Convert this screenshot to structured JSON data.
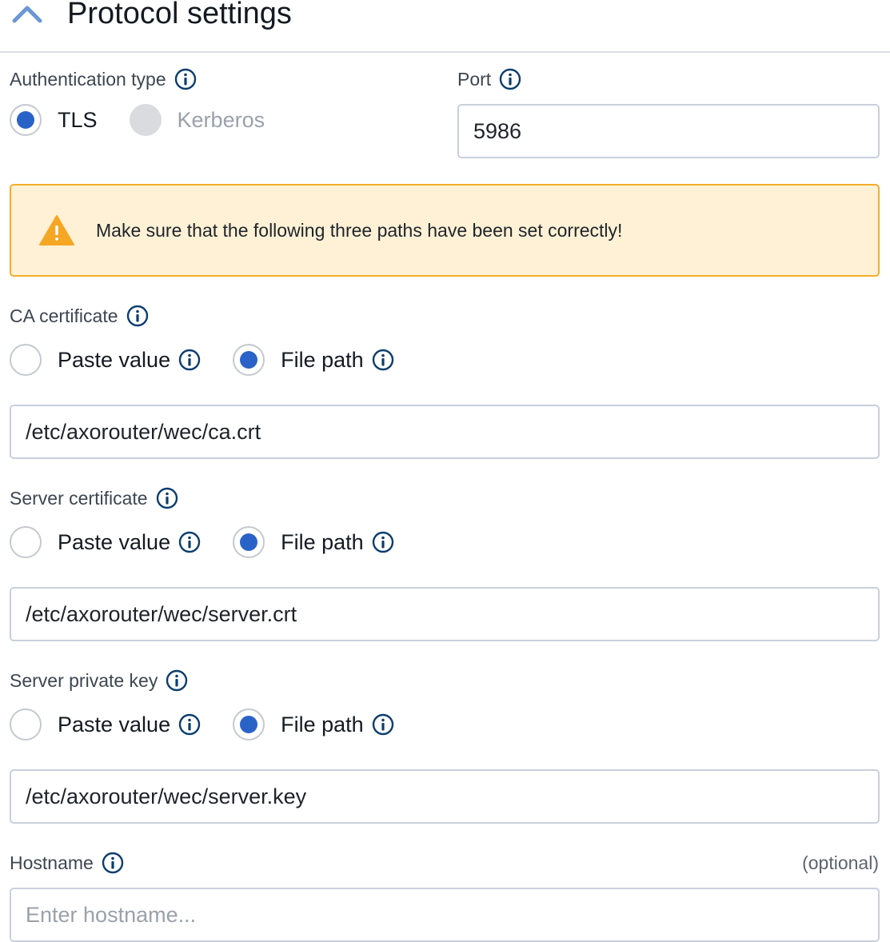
{
  "header": {
    "title": "Protocol settings",
    "collapse_icon": "chevron-up-icon"
  },
  "colors": {
    "accent": "#2a63c8",
    "warning_bg": "#fff1d6",
    "warning_border": "#f4ae2b",
    "info_icon": "#0b3d6e"
  },
  "auth": {
    "label": "Authentication type",
    "options": [
      {
        "label": "TLS",
        "selected": true,
        "disabled": false
      },
      {
        "label": "Kerberos",
        "selected": false,
        "disabled": true
      }
    ]
  },
  "port": {
    "label": "Port",
    "value": "5986"
  },
  "warning": {
    "icon": "warning-triangle-icon",
    "text": "Make sure that the following three paths have been set correctly!"
  },
  "ca_certificate": {
    "label": "CA certificate",
    "option_paste": "Paste value",
    "option_file": "File path",
    "selected": "file",
    "value": "/etc/axorouter/wec/ca.crt"
  },
  "server_certificate": {
    "label": "Server certificate",
    "option_paste": "Paste value",
    "option_file": "File path",
    "selected": "file",
    "value": "/etc/axorouter/wec/server.crt"
  },
  "server_private_key": {
    "label": "Server private key",
    "option_paste": "Paste value",
    "option_file": "File path",
    "selected": "file",
    "value": "/etc/axorouter/wec/server.key"
  },
  "hostname": {
    "label": "Hostname",
    "optional_text": "(optional)",
    "placeholder": "Enter hostname...",
    "value": ""
  }
}
